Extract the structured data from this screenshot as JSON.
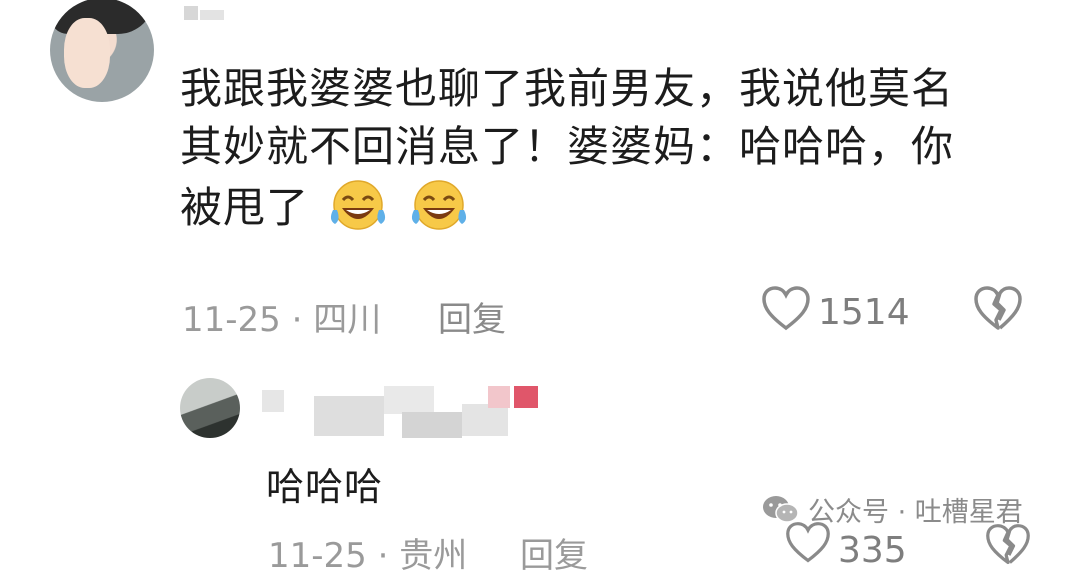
{
  "comment": {
    "text_line1": "我跟我婆婆也聊了我前男友，我说他莫名",
    "text_line2": "其妙就不回消息了！婆婆妈：哈哈哈，你",
    "text_line3": "被甩了",
    "emoji_icon": "tears-of-joy-emoji",
    "date": "11-25 · 四川",
    "reply_label": "回复",
    "like_count": "1514"
  },
  "reply": {
    "text": "哈哈哈",
    "date": "11-25 · 贵州",
    "reply_label": "回复",
    "like_count": "335"
  },
  "watermark": {
    "text": "公众号 · 吐槽星君",
    "icon": "wechat-icon"
  },
  "colors": {
    "meta_gray": "#9a9a9a",
    "text_dark": "#1c1c1c",
    "emoji_yellow": "#f7c948",
    "tear_blue": "#5fb0e8"
  }
}
